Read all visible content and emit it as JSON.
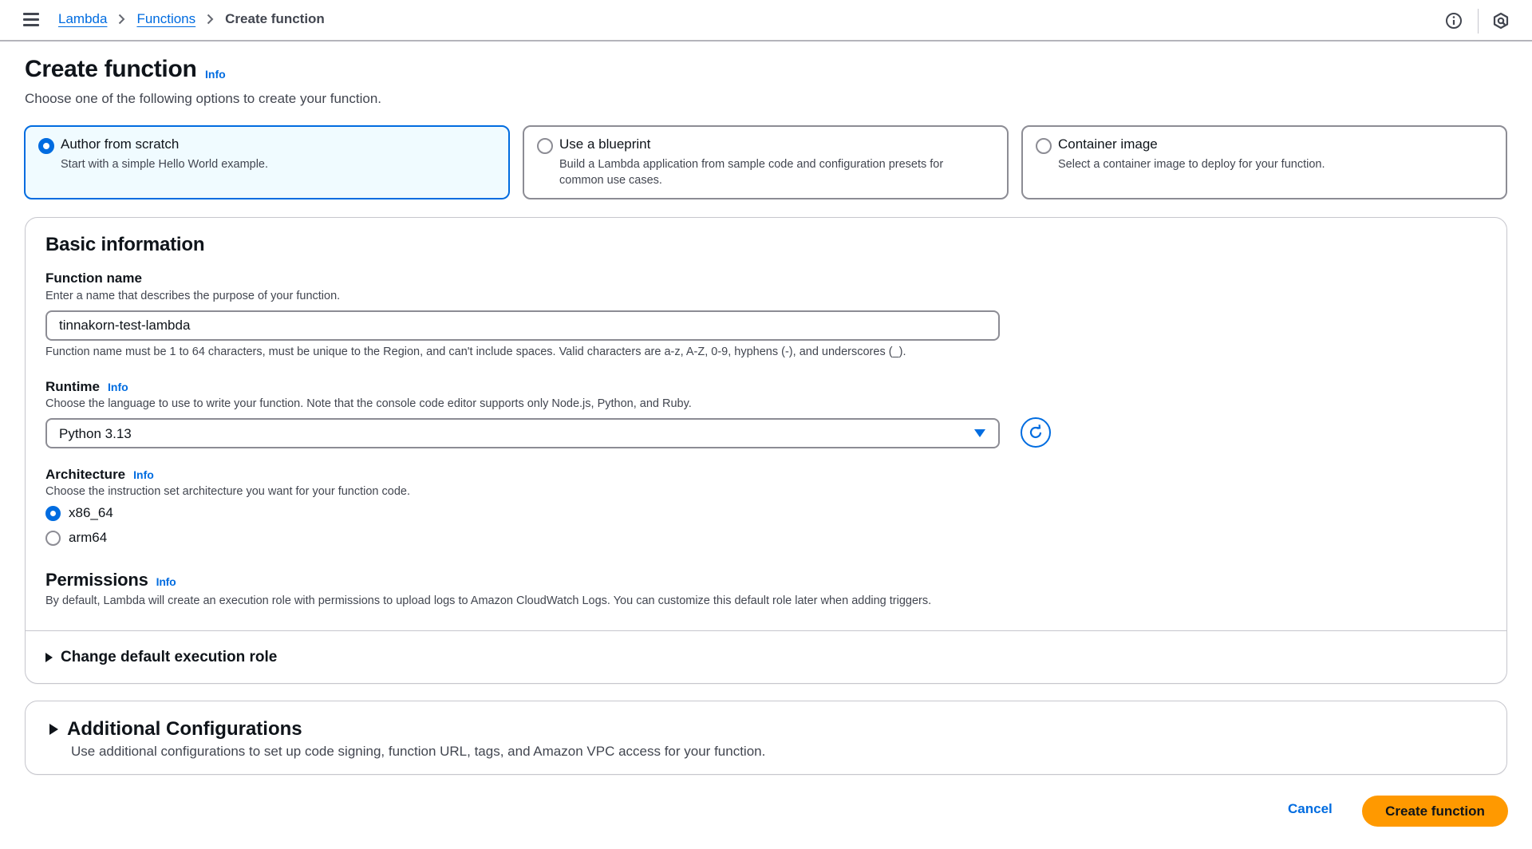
{
  "header": {
    "menu_icon": "hamburger-menu-icon",
    "breadcrumb": [
      {
        "label": "Lambda",
        "link": true
      },
      {
        "label": "Functions",
        "link": true
      },
      {
        "label": "Create function",
        "link": false
      }
    ],
    "right_icons": [
      "info-circle-icon",
      "hexagon-notifications-icon"
    ]
  },
  "page": {
    "title": "Create function",
    "info_label": "Info",
    "subtitle": "Choose one of the following options to create your function."
  },
  "creation_options": [
    {
      "title": "Author from scratch",
      "description": "Start with a simple Hello World example.",
      "selected": true
    },
    {
      "title": "Use a blueprint",
      "description": "Build a Lambda application from sample code and configuration presets for common use cases.",
      "selected": false
    },
    {
      "title": "Container image",
      "description": "Select a container image to deploy for your function.",
      "selected": false
    }
  ],
  "basic_information": {
    "heading": "Basic information",
    "function_name": {
      "label": "Function name",
      "description": "Enter a name that describes the purpose of your function.",
      "value": "tinnakorn-test-lambda",
      "hint": "Function name must be 1 to 64 characters, must be unique to the Region, and can't include spaces. Valid characters are a-z, A-Z, 0-9, hyphens (-), and underscores (_)."
    },
    "runtime": {
      "label": "Runtime",
      "info_label": "Info",
      "description": "Choose the language to use to write your function. Note that the console code editor supports only Node.js, Python, and Ruby.",
      "selected": "Python 3.13",
      "refresh_icon": "refresh-icon"
    },
    "architecture": {
      "label": "Architecture",
      "info_label": "Info",
      "description": "Choose the instruction set architecture you want for your function code.",
      "options": [
        {
          "label": "x86_64",
          "selected": true
        },
        {
          "label": "arm64",
          "selected": false
        }
      ]
    },
    "permissions": {
      "heading": "Permissions",
      "info_label": "Info",
      "description": "By default, Lambda will create an execution role with permissions to upload logs to Amazon CloudWatch Logs. You can customize this default role later when adding triggers.",
      "expander_label": "Change default execution role"
    }
  },
  "additional_configurations": {
    "heading": "Additional Configurations",
    "description": "Use additional configurations to set up code signing, function URL, tags, and Amazon VPC access for your function."
  },
  "footer": {
    "cancel_label": "Cancel",
    "create_label": "Create function"
  },
  "colors": {
    "accent_blue": "#006ce0",
    "primary_button": "#ff9900",
    "selected_card_bg": "#f0fbff"
  }
}
